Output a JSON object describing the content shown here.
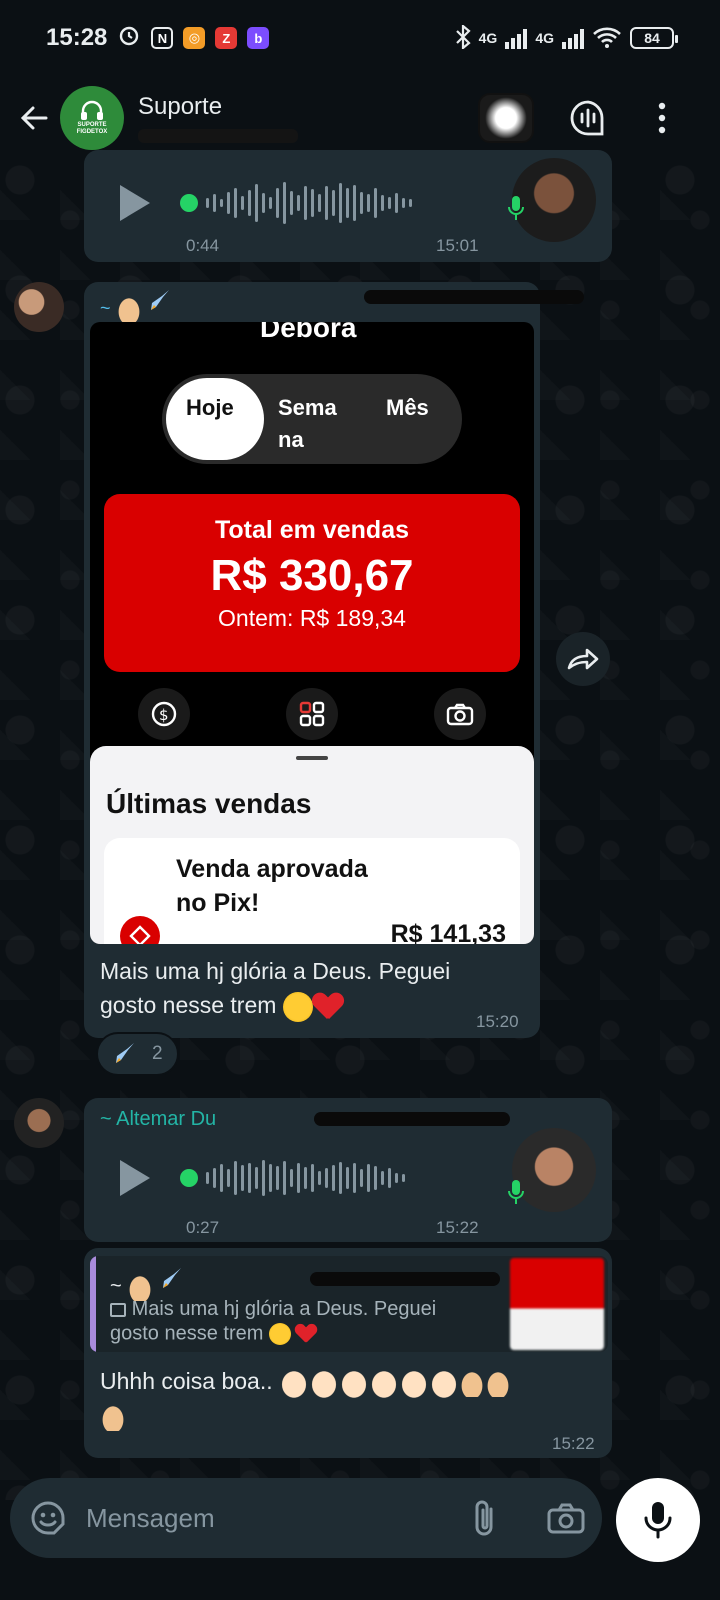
{
  "status": {
    "time": "15:28",
    "network": "4G",
    "battery": "84"
  },
  "header": {
    "title": "Suporte",
    "avatar_text": "SUPORTE FIGDETOX"
  },
  "messages": {
    "voice1": {
      "duration": "0:44",
      "time": "15:01"
    },
    "image_msg": {
      "sender_prefix": "~",
      "screenshot": {
        "name": "Debora",
        "tabs": [
          "Hoje",
          "Sema na",
          "Mês"
        ],
        "total_label": "Total em vendas",
        "total_value": "R$ 330,67",
        "yesterday": "Ontem: R$ 189,34",
        "sheet_title": "Últimas vendas",
        "sale_desc": "Venda aprovada no Pix!",
        "sale_amount": "R$ 141,33"
      },
      "caption_line1": "Mais uma hj glória a Deus. Peguei",
      "caption_line2": "gosto nesse trem",
      "time": "15:20",
      "reaction_count": "2"
    },
    "voice2": {
      "sender": "~ Altemar Du",
      "duration": "0:27",
      "time": "15:22"
    },
    "reply_msg": {
      "quote_sender": "~",
      "quote_line1": "Mais uma hj glória a Deus. Peguei",
      "quote_line2": "gosto nesse trem",
      "text": "Uhhh coisa boa..",
      "time": "15:22"
    }
  },
  "composer": {
    "placeholder": "Mensagem"
  },
  "colors": {
    "background": "#0b1014",
    "bubble": "#1f2c33",
    "accent_green": "#25d366",
    "sender_teal": "#53bdeb",
    "brand_red": "#d90000"
  }
}
